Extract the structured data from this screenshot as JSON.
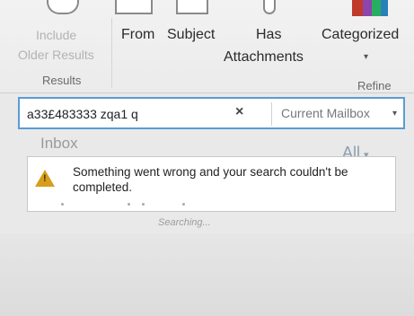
{
  "ribbon": {
    "include_older_line1": "Include",
    "include_older_line2": "Older Results",
    "results_group": "Results",
    "from": "From",
    "subject": "Subject",
    "has_attachments_line1": "Has",
    "has_attachments_line2": "Attachments",
    "categorized": "Categorized",
    "refine_group": "Refine"
  },
  "search": {
    "query": "a33£483333 zqa1 q",
    "clear_glyph": "×",
    "scope": "Current Mailbox",
    "chevron": "▾"
  },
  "folder": {
    "name": "Inbox",
    "filter": "All",
    "filter_chevron": "▾"
  },
  "error": {
    "message": "Something went wrong and your search couldn't be completed.",
    "icon": "warning-icon"
  },
  "status": {
    "searching": "Searching..."
  }
}
